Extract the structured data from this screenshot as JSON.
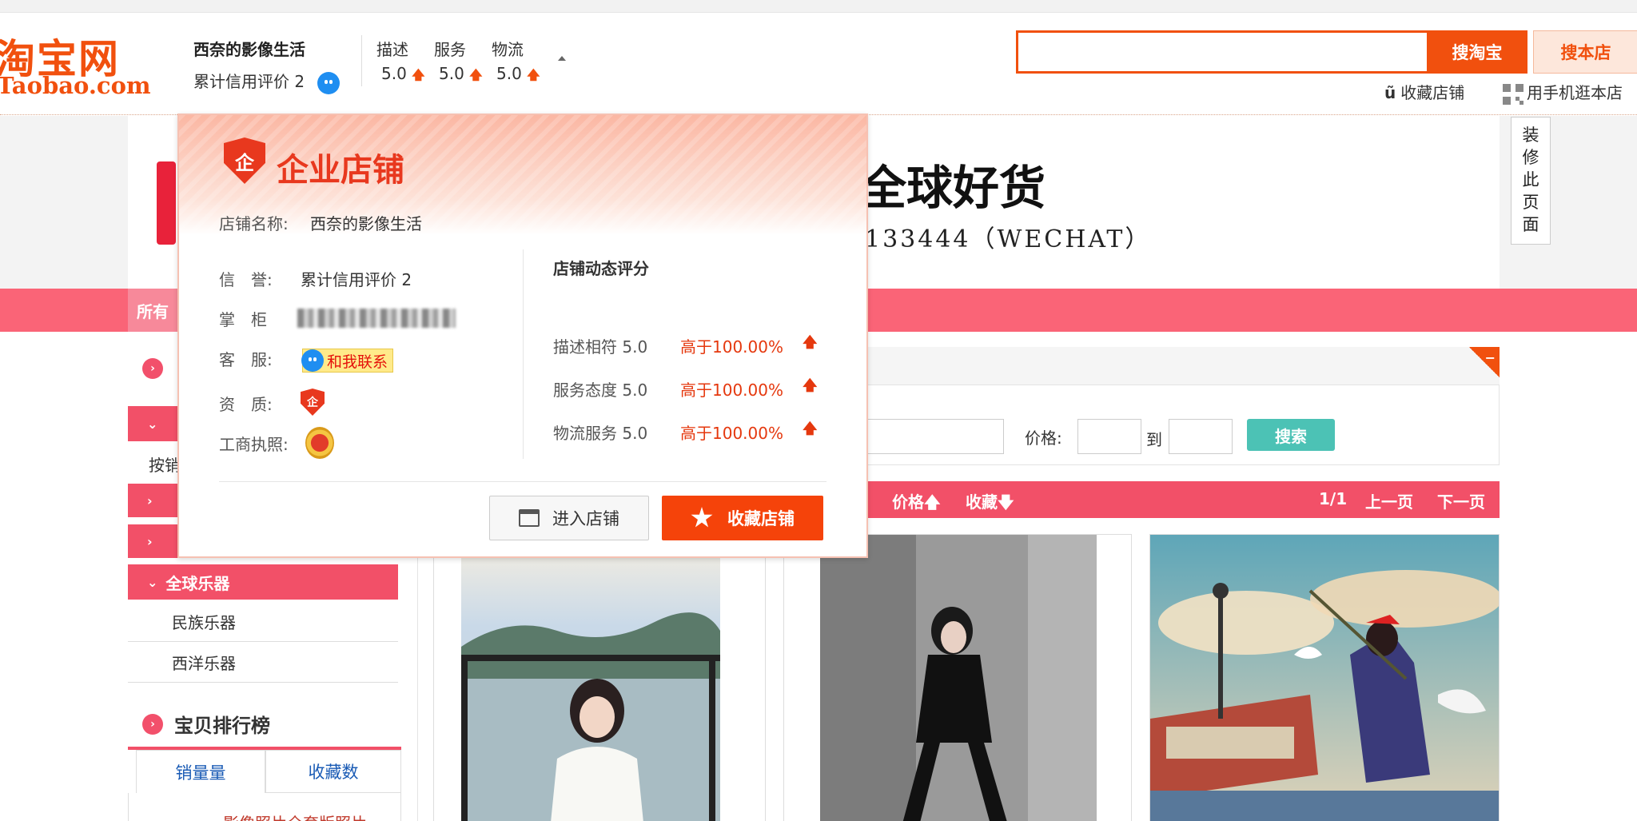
{
  "header": {
    "logo_cn": "淘宝网",
    "logo_en": "Taobao.com",
    "shop_name": "西奈的影像生活",
    "credit_text": "累计信用评价 2",
    "dsr": [
      {
        "label": "描述",
        "value": "5.0"
      },
      {
        "label": "服务",
        "value": "5.0"
      },
      {
        "label": "物流",
        "value": "5.0"
      }
    ],
    "search_placeholder": "",
    "search_taobao_label": "搜淘宝",
    "search_shop_label": "搜本店",
    "fav_shop_label": "收藏店铺",
    "mobile_label": "用手机逛本店"
  },
  "banner": {
    "title": "全球好货",
    "subtitle": "133444（WECHAT）",
    "decorate_label": "装修此页面"
  },
  "nav": {
    "all_label": "所有"
  },
  "sidebar": {
    "section1_letter": "",
    "sort_label": "按销",
    "category_selected": "全球乐器",
    "subcategories": [
      "民族乐器",
      "西洋乐器"
    ],
    "rank_title": "宝贝排行榜",
    "rank_tabs": [
      "销量量",
      "收藏数"
    ],
    "rank_item_partial": "影像照片全套版照片"
  },
  "content": {
    "price_label": "价格:",
    "to_label": "到",
    "search_button": "搜索",
    "corner_icon": "−",
    "sort_price": "价格",
    "sort_fav": "收藏",
    "page_indicator": "1/1",
    "prev_page": "上一页",
    "next_page": "下一页"
  },
  "popup": {
    "title": "企业店铺",
    "shield_char": "企",
    "shop_name_label": "店铺名称:",
    "shop_name_value": "西奈的影像生活",
    "credit_label": "信　誉:",
    "credit_value": "累计信用评价 2",
    "owner_label": "掌　柜",
    "service_label": "客　服:",
    "contact_label": "和我联系",
    "qualification_label": "资　质:",
    "license_label": "工商执照:",
    "dsr_title": "店铺动态评分",
    "dsr_rows": [
      {
        "label": "描述相符 5.0",
        "compare": "高于100.00%"
      },
      {
        "label": "服务态度 5.0",
        "compare": "高于100.00%"
      },
      {
        "label": "物流服务 5.0",
        "compare": "高于100.00%"
      }
    ],
    "enter_shop_label": "进入店铺",
    "fav_shop_label": "收藏店铺"
  },
  "colors": {
    "taobao_orange": "#f1500e",
    "shop_pink": "#f25068",
    "accent_teal": "#4cc2b5"
  }
}
